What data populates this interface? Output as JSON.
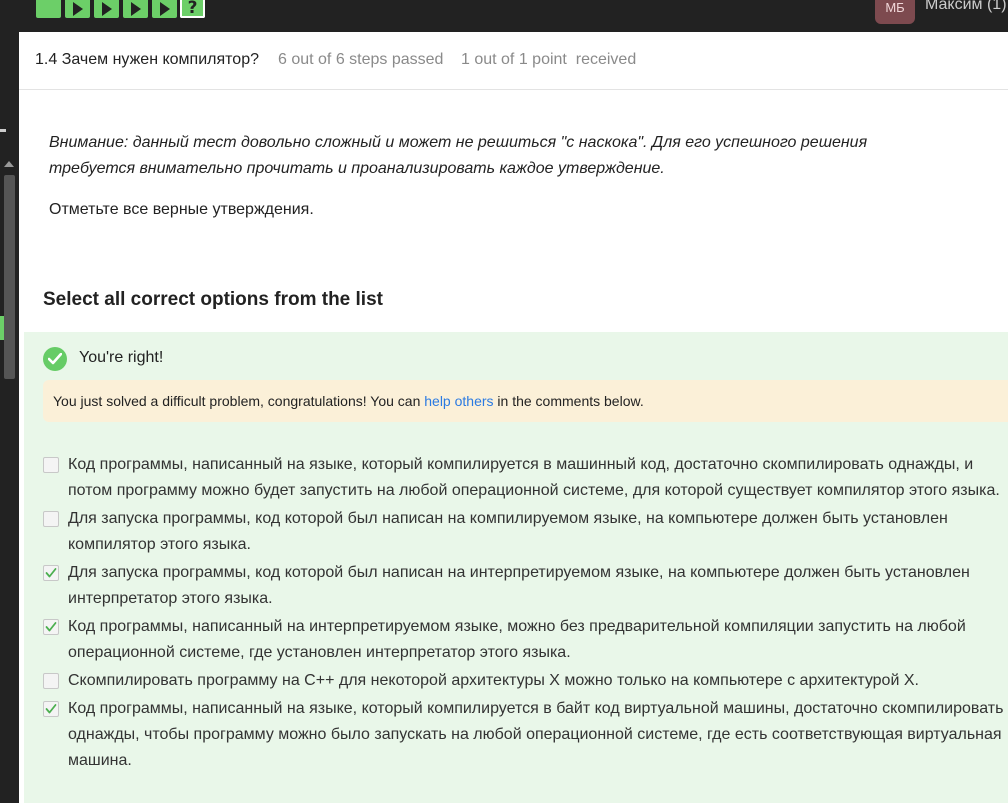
{
  "topbar": {
    "steps": [
      {
        "label": "",
        "icon": "solid-step"
      },
      {
        "label": "",
        "icon": "play-icon"
      },
      {
        "label": "",
        "icon": "play-icon"
      },
      {
        "label": "",
        "icon": "play-icon"
      },
      {
        "label": "",
        "icon": "play-icon"
      },
      {
        "label": "?",
        "icon": "question-step"
      }
    ],
    "avatar": "МБ",
    "user_name": "Максим (1)"
  },
  "header": {
    "lesson_title": "1.4 Зачем нужен компилятор?",
    "steps_passed": "6 out of 6 steps passed",
    "points": "1 out of 1 point  received"
  },
  "content": {
    "warning": "Внимание: данный тест довольно сложный и может не решиться \"с наскока\". Для его успешного решения требуется внимательно прочитать и проанализировать каждое утверждение.",
    "instruction": "Отметьте все верные утверждения."
  },
  "quiz": {
    "heading": "Select all correct options from the list",
    "result_text": "You're right!",
    "hint_before": "You just solved a difficult problem, congratulations! You can ",
    "hint_link": "help others",
    "hint_after": " in the comments below.",
    "options": [
      {
        "text": "Код программы, написанный на языке, который компилируется в машинный код, достаточно скомпилировать однажды, и потом программу можно будет запустить на любой операционной системе, для которой существует компилятор этого языка.",
        "checked": false
      },
      {
        "text": "Для запуска программы, код которой был написан на компилируемом языке, на компьютере должен быть установлен компилятор этого языка.",
        "checked": false
      },
      {
        "text": "Для запуска программы, код которой был написан на интерпретируемом языке, на компьютере должен быть установлен интерпретатор этого языка.",
        "checked": true
      },
      {
        "text": "Код программы, написанный на интерпретируемом языке, можно без предварительной компиляции запустить на любой операционной системе, где установлен интерпретатор этого языка.",
        "checked": true
      },
      {
        "text": "Скомпилировать программу на C++ для некоторой архитектуры X можно только на компьютере с архитектурой X.",
        "checked": false
      },
      {
        "text": "Код программы, написанный на языке, который компилируется в байт код виртуальной машины, достаточно скомпилировать однажды, чтобы программу можно было запускать на любой операционной системе, где есть соответствующая виртуальная машина.",
        "checked": true
      }
    ]
  },
  "colors": {
    "step_green": "#6ccf68",
    "success_bg": "#e9f7e9",
    "hint_bg": "#fbf0d8",
    "link": "#2a7ae2",
    "topbar": "#222222"
  }
}
